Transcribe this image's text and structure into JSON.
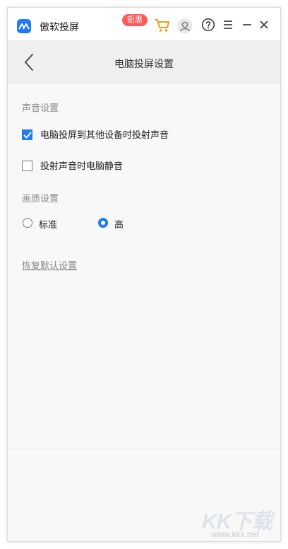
{
  "app": {
    "name": "傲软投屏",
    "promo_badge": "钜惠",
    "logo_icon": "airplay-logo-icon",
    "accent_color": "#1f7bf5"
  },
  "titlebar": {
    "icons": [
      "cart-icon",
      "avatar-icon",
      "help-icon",
      "menu-icon",
      "minimize-icon",
      "close-icon"
    ]
  },
  "nav": {
    "back_icon": "back-chevron-icon",
    "title": "电脑投屏设置"
  },
  "audio_section": {
    "label": "声音设置",
    "options": [
      {
        "label": "电脑投屏到其他设备时投射声音",
        "checked": true
      },
      {
        "label": "投射声音时电脑静音",
        "checked": false
      }
    ]
  },
  "quality_section": {
    "label": "画质设置",
    "options": [
      {
        "label": "标准",
        "selected": false
      },
      {
        "label": "高",
        "selected": true
      }
    ]
  },
  "reset_label": "恢复默认设置",
  "watermark": {
    "logo": "KK下载",
    "url": "www.kkx.net"
  }
}
